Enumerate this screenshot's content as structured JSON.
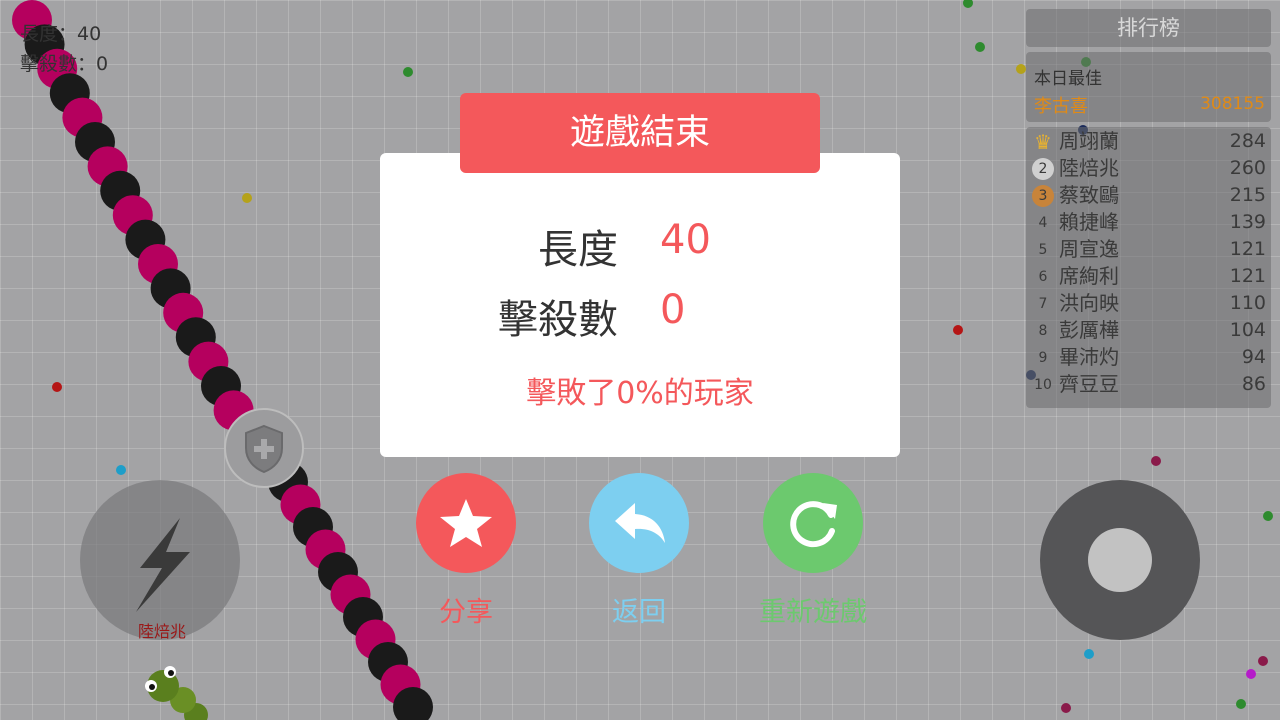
{
  "hud": {
    "length_text": "長度：40",
    "kills_text": "擊殺數：0"
  },
  "leaderboard": {
    "title": "排行榜",
    "best_label": "本日最佳",
    "best_name": "李古喜",
    "best_score": "308155",
    "rows": [
      {
        "rank": "",
        "name": "周翊蘭",
        "score": "284"
      },
      {
        "rank": "2",
        "name": "陸焙兆",
        "score": "260"
      },
      {
        "rank": "3",
        "name": "蔡致鷗",
        "score": "215"
      },
      {
        "rank": "4",
        "name": "賴捷峰",
        "score": "139"
      },
      {
        "rank": "5",
        "name": "周宣逸",
        "score": "121"
      },
      {
        "rank": "6",
        "name": "席絢利",
        "score": "121"
      },
      {
        "rank": "7",
        "name": "洪向映",
        "score": "110"
      },
      {
        "rank": "8",
        "name": "彭厲樺",
        "score": "104"
      },
      {
        "rank": "9",
        "name": "畢沛灼",
        "score": "94"
      },
      {
        "rank": "10",
        "name": "齊豆豆",
        "score": "86"
      }
    ]
  },
  "dialog": {
    "title": "遊戲結束",
    "length_label": "長度",
    "length_value": "40",
    "kills_label": "擊殺數",
    "kills_value": "0",
    "defeat_text": "擊敗了0%的玩家"
  },
  "buttons": {
    "share": "分享",
    "back": "返回",
    "restart": "重新遊戲"
  },
  "player_name_tag": "陸焙兆",
  "colors": {
    "accent_red": "#f4585b",
    "back_blue": "#7dcff0",
    "restart_green": "#6cc96e",
    "snake_magenta": "#b5005e",
    "snake_black": "#1a1a1a"
  }
}
